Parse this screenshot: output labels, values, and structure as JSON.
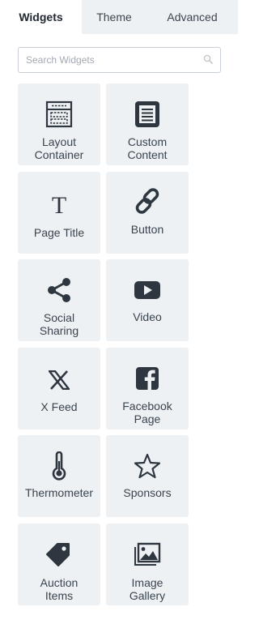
{
  "tabs": [
    {
      "label": "Widgets",
      "active": true
    },
    {
      "label": "Theme",
      "active": false
    },
    {
      "label": "Advanced",
      "active": false
    }
  ],
  "search": {
    "placeholder": "Search Widgets",
    "value": "",
    "icon": "search-icon"
  },
  "widgets": [
    {
      "label": "Layout\nContainer",
      "icon": "layout-container-icon"
    },
    {
      "label": "Custom\nContent",
      "icon": "document-lines-icon"
    },
    {
      "label": "Page Title",
      "icon": "title-t-icon"
    },
    {
      "label": "Button",
      "icon": "link-chain-icon"
    },
    {
      "label": "Social\nSharing",
      "icon": "share-icon"
    },
    {
      "label": "Video",
      "icon": "play-button-icon"
    },
    {
      "label": "X Feed",
      "icon": "x-logo-icon"
    },
    {
      "label": "Facebook\nPage",
      "icon": "facebook-logo-icon"
    },
    {
      "label": "Thermometer",
      "icon": "thermometer-icon"
    },
    {
      "label": "Sponsors",
      "icon": "star-outline-icon"
    },
    {
      "label": "Auction\nItems",
      "icon": "price-tag-icon"
    },
    {
      "label": "Image\nGallery",
      "icon": "image-gallery-icon"
    }
  ],
  "colors": {
    "icon": "#2e3740",
    "tile_bg": "#eef1f4",
    "tab_bar_bg": "#eef1f4"
  }
}
